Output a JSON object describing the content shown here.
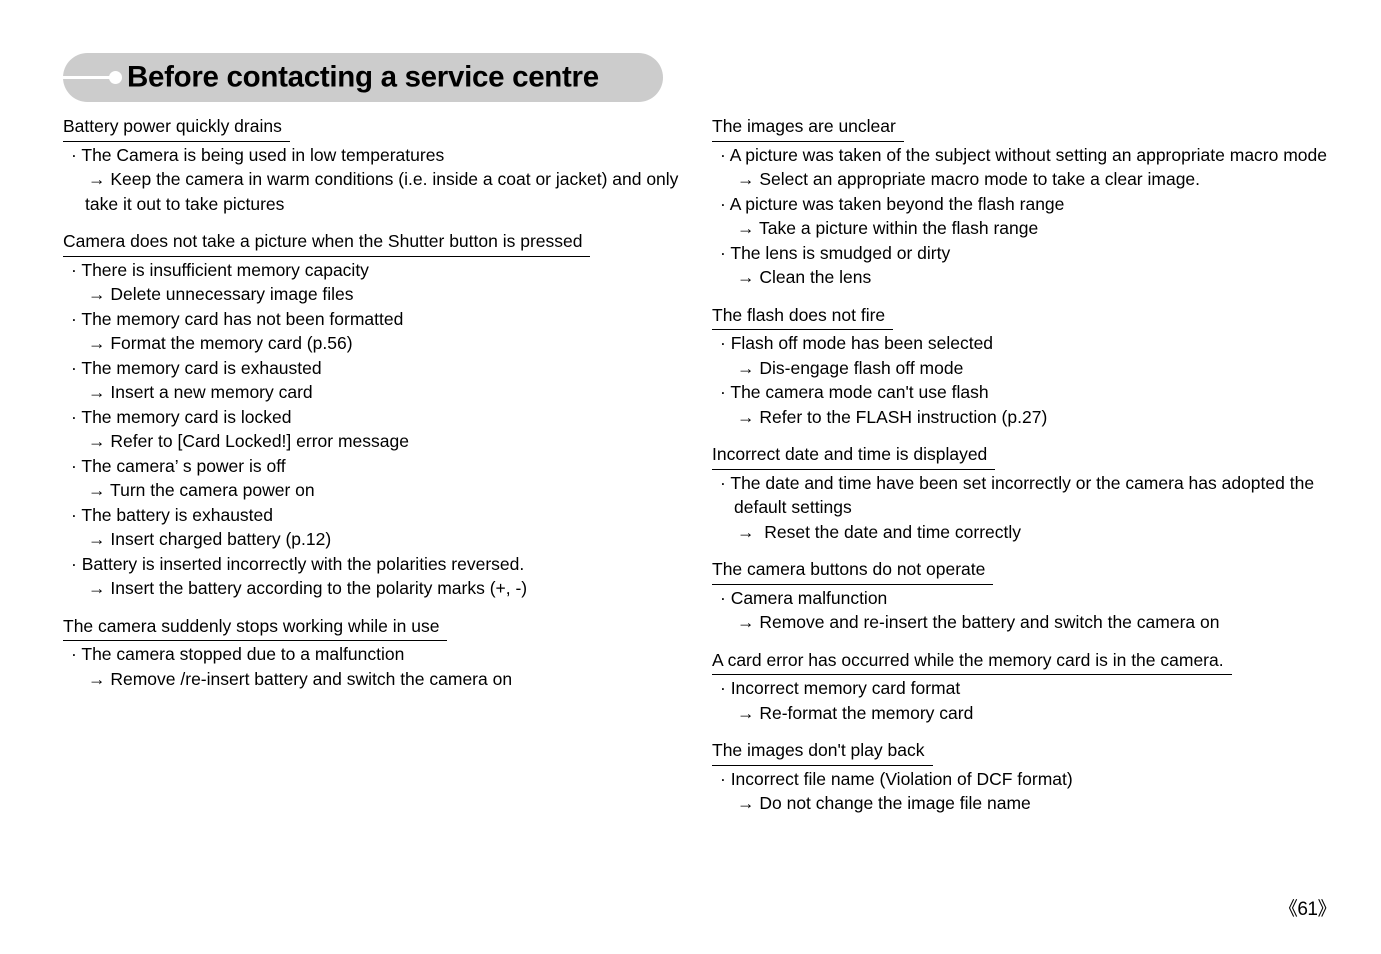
{
  "header": {
    "title": "Before contacting a service centre",
    "pill_color": "#cccccc",
    "accent_color": "#ffffff"
  },
  "bullet_marker": "·",
  "arrow_marker": "→",
  "left_column": [
    {
      "heading": "Battery power quickly drains",
      "lines": [
        {
          "type": "bullet",
          "text": "· The Camera is being used in low temperatures"
        },
        {
          "type": "arrow",
          "text": "→ Keep the camera in warm conditions (i.e. inside a coat or jacket) and only"
        },
        {
          "type": "cont",
          "text": "take it out to take pictures"
        }
      ]
    },
    {
      "heading": "Camera does not take a picture when the Shutter button is pressed",
      "lines": [
        {
          "type": "bullet",
          "text": "· There is insufficient memory capacity"
        },
        {
          "type": "arrow",
          "text": "→ Delete unnecessary image files"
        },
        {
          "type": "bullet",
          "text": "· The memory card has not been formatted"
        },
        {
          "type": "arrow",
          "text": "→ Format the memory card (p.56)"
        },
        {
          "type": "bullet",
          "text": "· The memory card is exhausted"
        },
        {
          "type": "arrow",
          "text": "→ Insert a new memory card"
        },
        {
          "type": "bullet",
          "text": "· The memory card is locked"
        },
        {
          "type": "arrow",
          "text": "→ Refer to [Card Locked!] error message"
        },
        {
          "type": "bullet",
          "text": "· The camera’ s power is off"
        },
        {
          "type": "arrow",
          "text": "→ Turn the camera power on"
        },
        {
          "type": "bullet",
          "text": "· The battery is exhausted"
        },
        {
          "type": "arrow",
          "text": "→ Insert charged battery (p.12)"
        },
        {
          "type": "bullet",
          "text": "· Battery is inserted incorrectly with the polarities reversed."
        },
        {
          "type": "arrow",
          "text": "→ Insert the battery according to the polarity marks (+, -)"
        }
      ]
    },
    {
      "heading": "The camera suddenly stops working while in use",
      "lines": [
        {
          "type": "bullet",
          "text": "· The camera stopped due to a malfunction"
        },
        {
          "type": "arrow",
          "text": "→ Remove /re-insert battery and switch the camera on"
        }
      ]
    }
  ],
  "right_column": [
    {
      "heading": "The images are unclear",
      "lines": [
        {
          "type": "bullet",
          "text": "· A picture was taken of the subject without setting an appropriate macro mode"
        },
        {
          "type": "arrow",
          "text": "→ Select an appropriate macro mode to take a clear image."
        },
        {
          "type": "bullet",
          "text": "· A picture was taken beyond the flash range"
        },
        {
          "type": "arrow",
          "text": "→ Take a picture within the flash range"
        },
        {
          "type": "bullet",
          "text": "· The lens is smudged or dirty"
        },
        {
          "type": "arrow",
          "text": "→ Clean the lens"
        }
      ]
    },
    {
      "heading": "The flash does not fire",
      "lines": [
        {
          "type": "bullet",
          "text": "· Flash off mode has been selected"
        },
        {
          "type": "arrow",
          "text": "→ Dis-engage flash off mode"
        },
        {
          "type": "bullet",
          "text": "· The camera mode can't use flash"
        },
        {
          "type": "arrow",
          "text": "→ Refer to the FLASH instruction (p.27)"
        }
      ]
    },
    {
      "heading": "Incorrect date and time is displayed",
      "lines": [
        {
          "type": "bullet",
          "text": "· The date and time have been set incorrectly or the camera has adopted the"
        },
        {
          "type": "cont",
          "text": "default settings"
        },
        {
          "type": "arrow",
          "text": "→  Reset the date and time correctly"
        }
      ]
    },
    {
      "heading": "The camera buttons do not operate",
      "lines": [
        {
          "type": "bullet",
          "text": "· Camera malfunction"
        },
        {
          "type": "arrow",
          "text": "→ Remove and re-insert the battery and switch the camera on"
        }
      ]
    },
    {
      "heading": "A card error has occurred while the memory card is in the camera.",
      "lines": [
        {
          "type": "bullet",
          "text": "· Incorrect memory card format"
        },
        {
          "type": "arrow",
          "text": "→ Re-format the memory card"
        }
      ]
    },
    {
      "heading": "The images don't play back",
      "lines": [
        {
          "type": "bullet",
          "text": "· Incorrect file name (Violation of DCF format)"
        },
        {
          "type": "arrow",
          "text": "→ Do not change the image file name"
        }
      ]
    }
  ],
  "footer": {
    "page_number": "《61》"
  }
}
